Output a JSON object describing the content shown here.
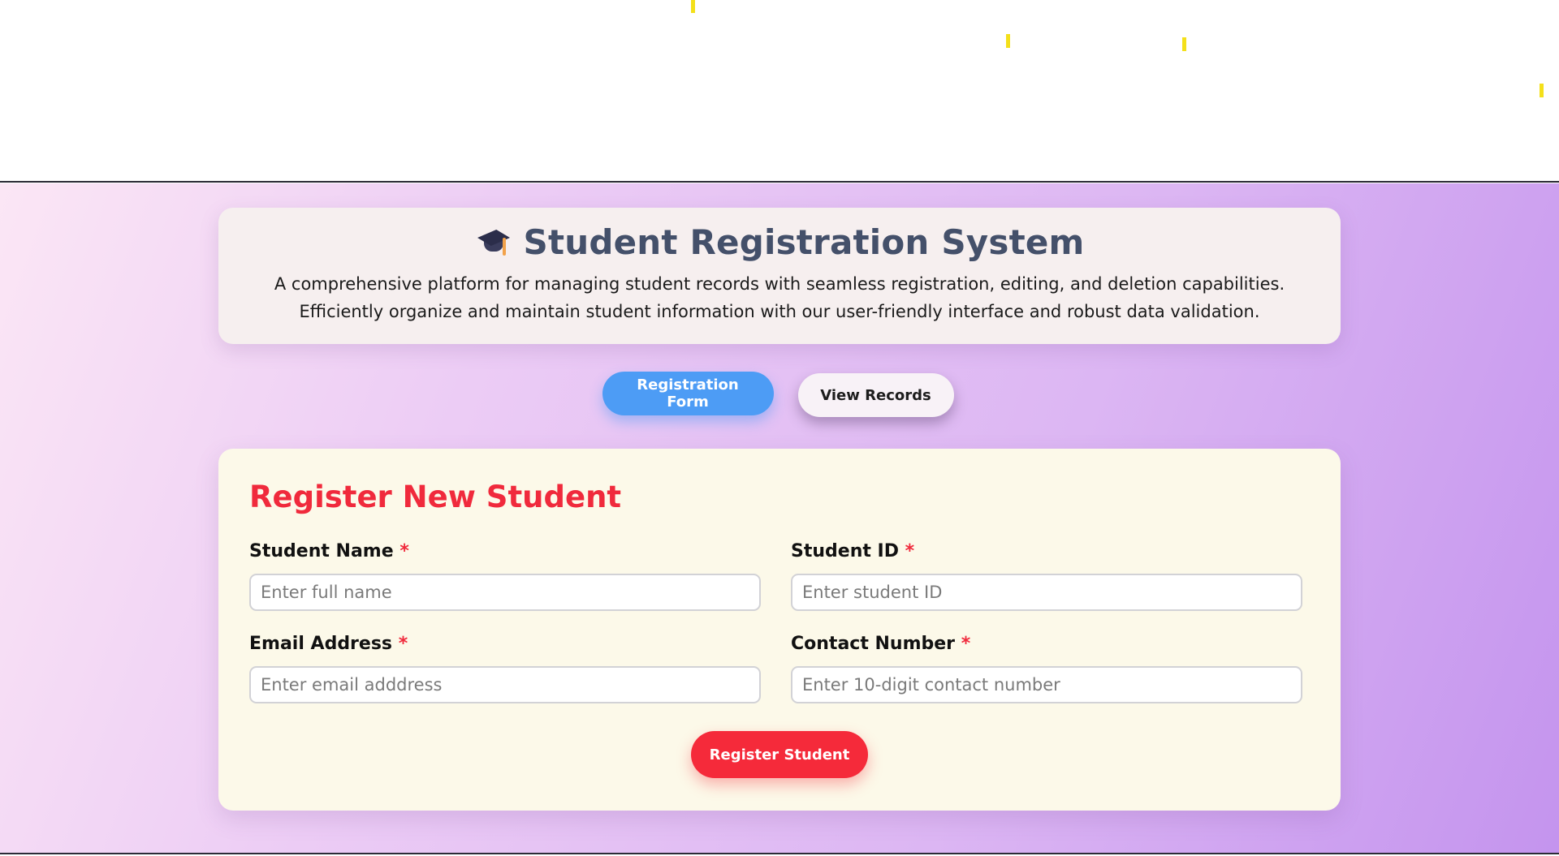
{
  "header": {
    "icon": "graduation-cap-icon",
    "title": "Student Registration System",
    "description_line1": "A comprehensive platform for managing student records with seamless registration, editing, and deletion capabilities.",
    "description_line2": "Efficiently organize and maintain student information with our user-friendly interface and robust data validation."
  },
  "tabs": [
    {
      "label": "Registration Form",
      "active": true
    },
    {
      "label": "View Records",
      "active": false
    }
  ],
  "form": {
    "title": "Register New Student",
    "required_marker": "*",
    "fields": {
      "student_name": {
        "label": "Student Name",
        "placeholder": "Enter full name",
        "value": ""
      },
      "student_id": {
        "label": "Student ID",
        "placeholder": "Enter student ID",
        "value": ""
      },
      "email": {
        "label": "Email Address",
        "placeholder": "Enter email adddress",
        "value": ""
      },
      "contact": {
        "label": "Contact Number",
        "placeholder": "Enter 10-digit contact number",
        "value": ""
      }
    },
    "submit_label": "Register Student"
  },
  "colors": {
    "accent_blue": "#4d9cf5",
    "accent_red": "#f02a3c",
    "title_slate": "#44506a",
    "confetti_yellow": "#f4e01a"
  }
}
